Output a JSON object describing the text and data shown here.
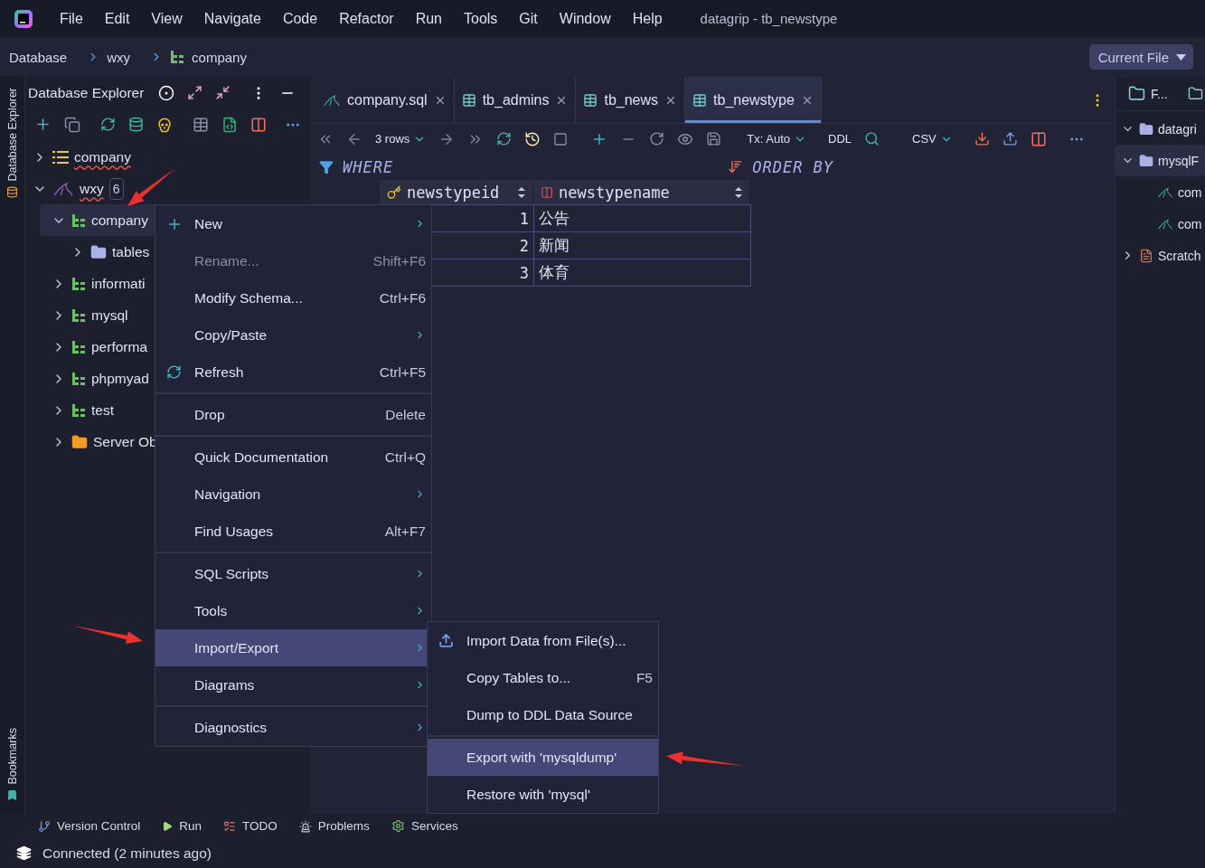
{
  "menu_bar": {
    "items": [
      "File",
      "Edit",
      "View",
      "Navigate",
      "Code",
      "Refactor",
      "Run",
      "Tools",
      "Git",
      "Window",
      "Help"
    ],
    "title": "datagrip - tb_newstype"
  },
  "breadcrumbs": [
    "Database",
    "wxy",
    "company"
  ],
  "scope_button": "Current File",
  "side_tabs": {
    "top": "Database Explorer",
    "bottom": "Bookmarks"
  },
  "explorer": {
    "title": "Database Explorer",
    "tree": [
      {
        "label": "company",
        "kind": "list",
        "expanded": false,
        "selected": false,
        "wavy": true
      },
      {
        "label": "wxy",
        "kind": "datasource",
        "expanded": true,
        "selected": false,
        "wavy": true,
        "badge": "6",
        "children": [
          {
            "label": "company",
            "kind": "schema",
            "expanded": true,
            "selected": true,
            "wavy": false,
            "children": [
              {
                "label": "tables",
                "kind": "folder",
                "expanded": false,
                "selected": false,
                "wavy": false
              }
            ]
          },
          {
            "label": "informati",
            "kind": "schema",
            "expanded": false,
            "selected": false,
            "wavy": false
          },
          {
            "label": "mysql",
            "kind": "schema",
            "expanded": false,
            "selected": false,
            "wavy": false
          },
          {
            "label": "performa",
            "kind": "schema",
            "expanded": false,
            "selected": false,
            "wavy": false
          },
          {
            "label": "phpmyad",
            "kind": "schema",
            "expanded": false,
            "selected": false,
            "wavy": false
          },
          {
            "label": "test",
            "kind": "schema",
            "expanded": false,
            "selected": false,
            "wavy": false
          },
          {
            "label": "Server Ob",
            "kind": "server",
            "expanded": false,
            "selected": false,
            "wavy": false
          }
        ]
      }
    ]
  },
  "editor": {
    "tabs": [
      {
        "label": "company.sql",
        "kind": "sql",
        "selected": false
      },
      {
        "label": "tb_admins",
        "kind": "table",
        "selected": false
      },
      {
        "label": "tb_news",
        "kind": "table",
        "selected": false
      },
      {
        "label": "tb_newstype",
        "kind": "table",
        "selected": true
      }
    ],
    "toolbar": {
      "rows": "3 rows",
      "transaction": "Tx: Auto",
      "ddl": "DDL",
      "format": "CSV"
    },
    "filter": {
      "where": "WHERE",
      "order_by": "ORDER BY"
    },
    "grid": {
      "columns": [
        {
          "name": "newstypeid",
          "kind": "key"
        },
        {
          "name": "newstypename",
          "kind": "field"
        }
      ],
      "rows": [
        [
          "1",
          "公告"
        ],
        [
          "2",
          "新闻"
        ],
        [
          "3",
          "体育"
        ]
      ]
    }
  },
  "right_panel": {
    "tab": "F...",
    "tree": [
      {
        "label": "datagri",
        "expanded": true,
        "selected": false
      },
      {
        "label": "mysqlF",
        "expanded": true,
        "selected": true,
        "children": [
          {
            "label": "com"
          },
          {
            "label": "com"
          }
        ]
      },
      {
        "label": "Scratch",
        "expanded": false,
        "selected": false
      }
    ]
  },
  "context_menu": {
    "items": [
      {
        "kind": "add",
        "label": "New",
        "submenu": true,
        "disabled": false,
        "selected": false
      },
      {
        "kind": "item",
        "label": "Rename...",
        "shortcut": "Shift+F6",
        "submenu": false,
        "disabled": true,
        "selected": false
      },
      {
        "kind": "item",
        "label": "Modify Schema...",
        "shortcut": "Ctrl+F6",
        "submenu": false,
        "disabled": false,
        "selected": false
      },
      {
        "kind": "item",
        "label": "Copy/Paste",
        "submenu": true,
        "disabled": false,
        "selected": false
      },
      {
        "kind": "refresh",
        "label": "Refresh",
        "shortcut": "Ctrl+F5",
        "submenu": false,
        "disabled": false,
        "selected": false
      },
      {
        "kind": "separator"
      },
      {
        "kind": "item",
        "label": "Drop",
        "shortcut": "Delete",
        "submenu": false,
        "disabled": false,
        "selected": false
      },
      {
        "kind": "separator"
      },
      {
        "kind": "item",
        "label": "Quick Documentation",
        "shortcut": "Ctrl+Q",
        "submenu": false,
        "disabled": false,
        "selected": false
      },
      {
        "kind": "item",
        "label": "Navigation",
        "submenu": true,
        "disabled": false,
        "selected": false
      },
      {
        "kind": "item",
        "label": "Find Usages",
        "shortcut": "Alt+F7",
        "submenu": false,
        "disabled": false,
        "selected": false
      },
      {
        "kind": "separator"
      },
      {
        "kind": "item",
        "label": "SQL Scripts",
        "submenu": true,
        "disabled": false,
        "selected": false
      },
      {
        "kind": "item",
        "label": "Tools",
        "submenu": true,
        "disabled": false,
        "selected": false
      },
      {
        "kind": "item",
        "label": "Import/Export",
        "submenu": true,
        "disabled": false,
        "selected": true
      },
      {
        "kind": "item",
        "label": "Diagrams",
        "submenu": true,
        "disabled": false,
        "selected": false
      },
      {
        "kind": "separator"
      },
      {
        "kind": "item",
        "label": "Diagnostics",
        "submenu": true,
        "disabled": false,
        "selected": false
      }
    ]
  },
  "submenu": {
    "items": [
      {
        "kind": "import",
        "label": "Import Data from File(s)...",
        "submenu": false,
        "disabled": false,
        "selected": false
      },
      {
        "kind": "item",
        "label": "Copy Tables to...",
        "shortcut": "F5",
        "submenu": false,
        "disabled": false,
        "selected": false
      },
      {
        "kind": "item",
        "label": "Dump to DDL Data Source",
        "submenu": false,
        "disabled": false,
        "selected": false
      },
      {
        "kind": "separator"
      },
      {
        "kind": "item",
        "label": "Export with 'mysqldump'",
        "submenu": false,
        "disabled": false,
        "selected": true
      },
      {
        "kind": "item",
        "label": "Restore with 'mysql'",
        "submenu": false,
        "disabled": false,
        "selected": false
      }
    ]
  },
  "tool_windows": [
    {
      "label": "Version Control",
      "kind": "vcs"
    },
    {
      "label": "Run",
      "kind": "run"
    },
    {
      "label": "TODO",
      "kind": "todo"
    },
    {
      "label": "Problems",
      "kind": "problems"
    },
    {
      "label": "Services",
      "kind": "services"
    }
  ],
  "status": "Connected (2 minutes ago)"
}
